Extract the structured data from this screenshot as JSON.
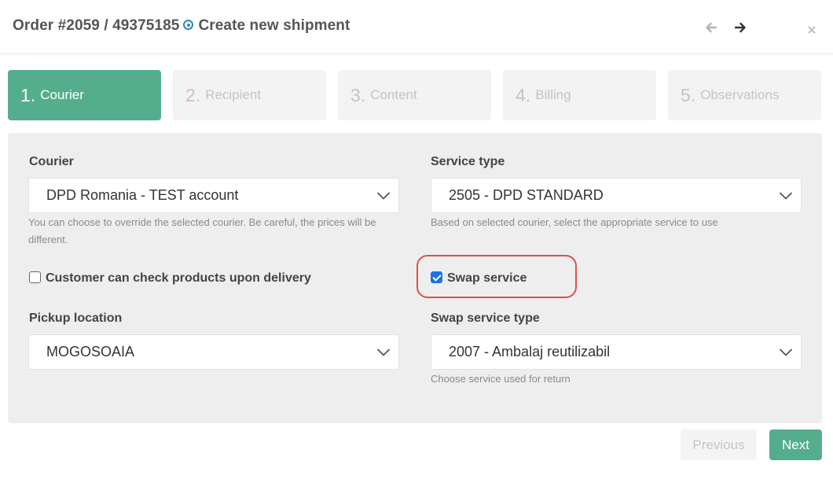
{
  "header": {
    "order_label": "Order #2059 / 49375185",
    "title": "Create new shipment"
  },
  "steps": [
    {
      "num": "1.",
      "label": "Courier",
      "active": true
    },
    {
      "num": "2.",
      "label": "Recipient",
      "active": false
    },
    {
      "num": "3.",
      "label": "Content",
      "active": false
    },
    {
      "num": "4.",
      "label": "Billing",
      "active": false
    },
    {
      "num": "5.",
      "label": "Observations",
      "active": false
    }
  ],
  "form": {
    "courier": {
      "label": "Courier",
      "value": "DPD Romania - TEST account",
      "help": "You can choose to override the selected courier. Be careful, the prices will be different."
    },
    "service_type": {
      "label": "Service type",
      "value": "2505 - DPD STANDARD",
      "help": "Based on selected courier, select the appropriate service to use"
    },
    "check_products": {
      "label": "Customer can check products upon delivery",
      "checked": false
    },
    "swap_service": {
      "label": "Swap service",
      "checked": true
    },
    "pickup_location": {
      "label": "Pickup location",
      "value": "MOGOSOAIA"
    },
    "swap_service_type": {
      "label": "Swap service type",
      "value": "2007 - Ambalaj reutilizabil",
      "help": "Choose service used for return"
    }
  },
  "footer": {
    "previous_label": "Previous",
    "next_label": "Next"
  },
  "colors": {
    "accent": "#54ae8e",
    "highlight": "#d9534f",
    "checkbox": "#1a73e8"
  },
  "icons": {
    "target": "target-icon",
    "back": "arrow-left-icon",
    "forward": "arrow-right-icon",
    "close": "close-icon",
    "dropdown": "chevron-down-icon"
  }
}
